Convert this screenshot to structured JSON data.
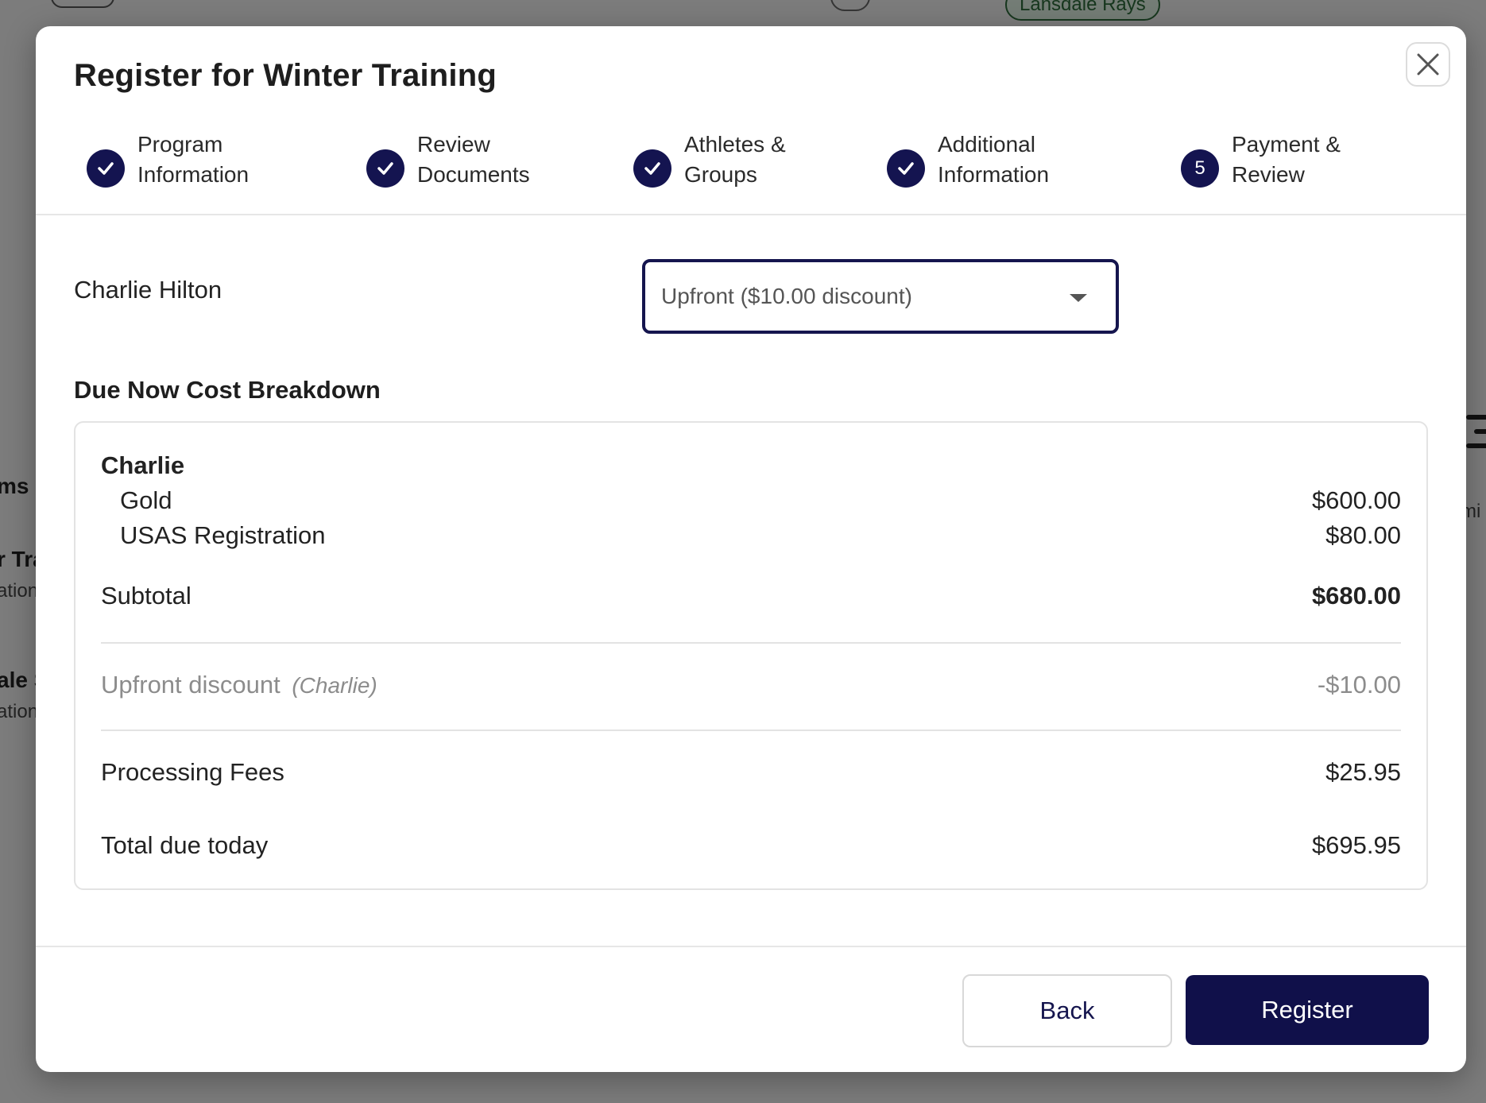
{
  "background": {
    "team_badge": "Lansdale Rays",
    "fragments": [
      "ms",
      "r Tra",
      "ation",
      "ale S",
      "ation",
      "mi"
    ]
  },
  "modal": {
    "title": "Register for Winter Training",
    "close_icon": "close-icon",
    "steps": [
      {
        "marker": "check",
        "line1": "Program",
        "line2": "Information"
      },
      {
        "marker": "check",
        "line1": "Review",
        "line2": "Documents"
      },
      {
        "marker": "check",
        "line1": "Athletes &",
        "line2": "Groups"
      },
      {
        "marker": "check",
        "line1": "Additional",
        "line2": "Information"
      },
      {
        "marker": "5",
        "line1": "Payment &",
        "line2": "Review"
      }
    ],
    "athlete_name": "Charlie Hilton",
    "payment_option": {
      "selected": "Upfront ($10.00 discount)"
    },
    "breakdown_title": "Due Now Cost Breakdown",
    "breakdown": {
      "athlete": "Charlie",
      "items": [
        {
          "label": "Gold",
          "amount": "$600.00"
        },
        {
          "label": "USAS Registration",
          "amount": "$80.00"
        }
      ],
      "subtotal_label": "Subtotal",
      "subtotal": "$680.00",
      "discount_label": "Upfront discount",
      "discount_who": "(Charlie)",
      "discount_amount": "-$10.00",
      "fees_label": "Processing Fees",
      "fees_amount": "$25.95",
      "total_label": "Total due today",
      "total_amount": "$695.95"
    },
    "buttons": {
      "back": "Back",
      "register": "Register"
    }
  },
  "colors": {
    "primary": "#10104a",
    "step_active": "#141450",
    "muted_text": "#8c8c8c",
    "badge_green": "#2d6a3a"
  }
}
